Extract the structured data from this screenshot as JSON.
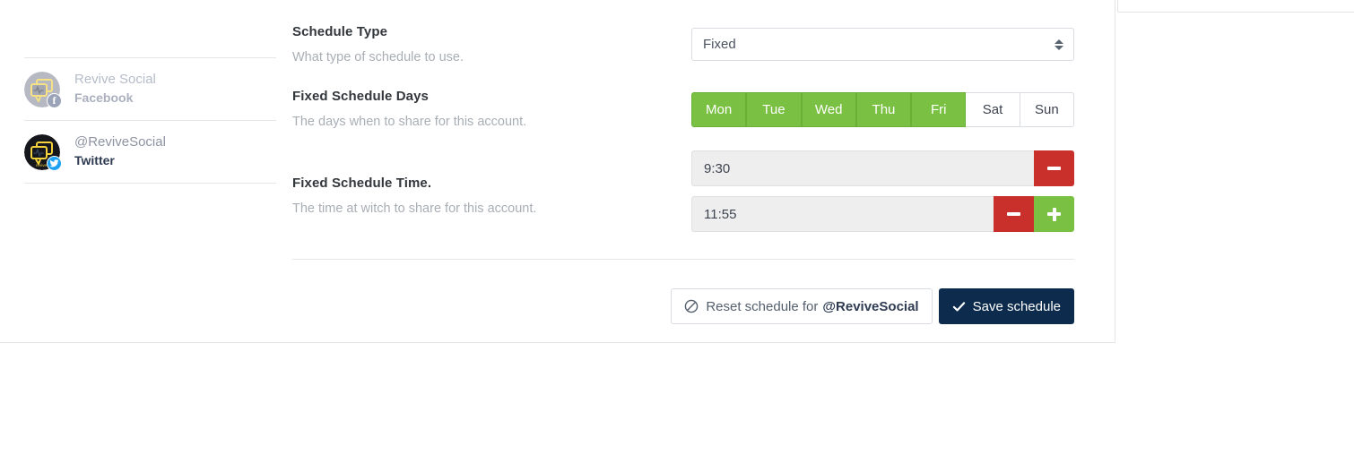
{
  "accounts": [
    {
      "name": "Revive Social",
      "network": "Facebook",
      "network_icon": "facebook-icon",
      "avatar_icon": "revive-social-logo",
      "active": false
    },
    {
      "name": "@ReviveSocial",
      "network": "Twitter",
      "network_icon": "twitter-icon",
      "avatar_icon": "revive-social-logo",
      "active": true
    }
  ],
  "form": {
    "schedule_type": {
      "label": "Schedule Type",
      "description": "What type of schedule to use.",
      "value": "Fixed"
    },
    "schedule_days": {
      "label": "Fixed Schedule Days",
      "description": "The days when to share for this account.",
      "days": [
        {
          "label": "Mon",
          "selected": true
        },
        {
          "label": "Tue",
          "selected": true
        },
        {
          "label": "Wed",
          "selected": true
        },
        {
          "label": "Thu",
          "selected": true
        },
        {
          "label": "Fri",
          "selected": true
        },
        {
          "label": "Sat",
          "selected": false
        },
        {
          "label": "Sun",
          "selected": false
        }
      ]
    },
    "schedule_time": {
      "label": "Fixed Schedule Time.",
      "description": "The time at witch to share for this account.",
      "times": [
        {
          "value": "9:30",
          "has_remove": true,
          "has_add": false
        },
        {
          "value": "11:55",
          "has_remove": true,
          "has_add": true
        }
      ]
    }
  },
  "actions": {
    "reset_label": "Reset schedule for",
    "reset_account": "@ReviveSocial",
    "reset_icon": "ban-icon",
    "save_label": "Save schedule",
    "save_icon": "check-icon"
  },
  "colors": {
    "green": "#7ac143",
    "red": "#c9302c",
    "navy": "#0d2c4d",
    "twitter_blue": "#1da1f2"
  }
}
